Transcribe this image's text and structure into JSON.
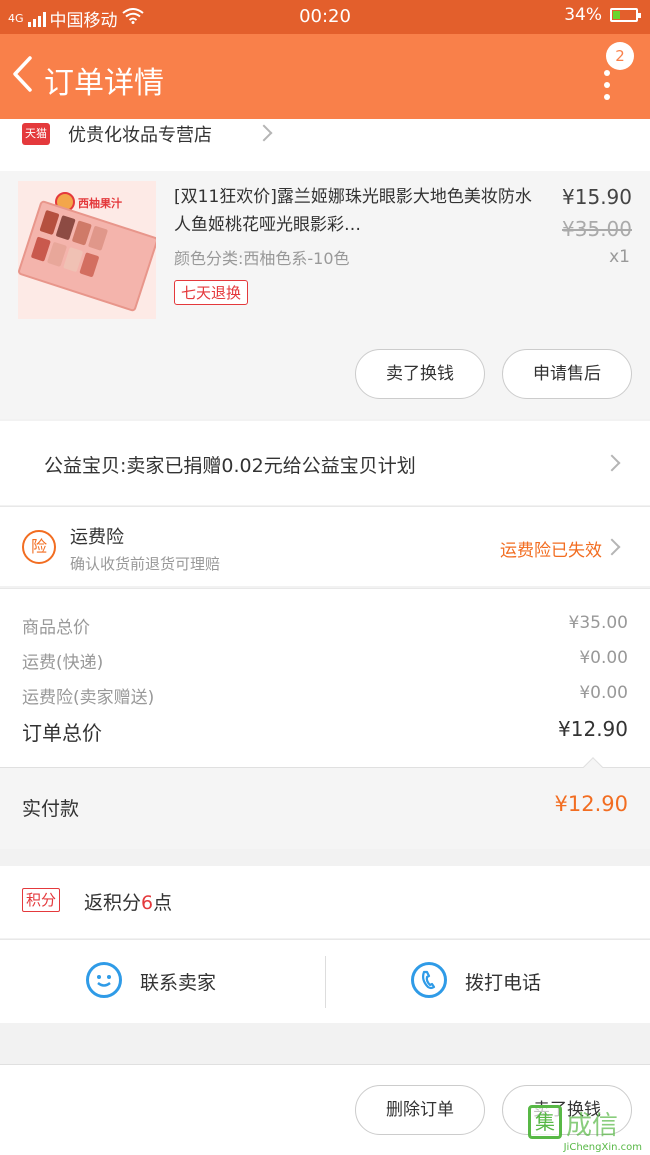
{
  "status_bar": {
    "network": "4G",
    "carrier": "中国移动",
    "time": "00:20",
    "battery": "34%",
    "battery_level": 0.34
  },
  "navbar": {
    "back_glyph": "<",
    "title": "订单详情",
    "badge": "2"
  },
  "shop": {
    "badge": "天猫",
    "name": "优贵化妆品专营店"
  },
  "product": {
    "image_logo": "西柚果汁",
    "title": "[双11狂欢价]露兰姬娜珠光眼影大地色美妆防水人鱼姬桃花哑光眼影彩…",
    "sku": "颜色分类:西柚色系-10色",
    "tag": "七天退换",
    "price": "¥15.90",
    "original_price": "¥35.00",
    "qty": "x1",
    "swatch_colors": [
      "#b5503f",
      "#8d4b43",
      "#cf7a68",
      "#e0978a",
      "#c9594d",
      "#e8a79a",
      "#f0c1b4",
      "#d36e60"
    ]
  },
  "actions": {
    "buy_again": "卖了换钱",
    "after_sale": "申请售后"
  },
  "charity": {
    "text": "公益宝贝:卖家已捐赠0.02元给公益宝贝计划"
  },
  "insurance": {
    "icon_text": "险",
    "title": "运费险",
    "subtitle": "确认收货前退货可理赔",
    "status": "运费险已失效"
  },
  "totals": {
    "lines": [
      {
        "label": "商品总价",
        "value": "¥35.00"
      },
      {
        "label": "运费(快递)",
        "value": "¥0.00"
      },
      {
        "label": "运费险(卖家赠送)",
        "value": "¥0.00"
      },
      {
        "label": "订单总价",
        "value": "¥12.90"
      }
    ],
    "paid_label": "实付款",
    "paid_value": "¥12.90"
  },
  "points": {
    "tag": "积分",
    "prefix": "返积分",
    "count": "6",
    "suffix": "点"
  },
  "contact": {
    "seller_label": "联系卖家",
    "call_label": "拨打电话"
  },
  "footer": {
    "delete_order": "删除订单",
    "buy_again": "卖了换钱"
  },
  "watermark": {
    "mark": "集",
    "text": "成信",
    "url": "JiChengXin.com"
  },
  "colors": {
    "status_bar": "#e35f2c",
    "navbar": "#f9804a",
    "accent_orange": "#f26d21",
    "tmall_red": "#e4393c",
    "link_blue": "#2f9be7"
  }
}
